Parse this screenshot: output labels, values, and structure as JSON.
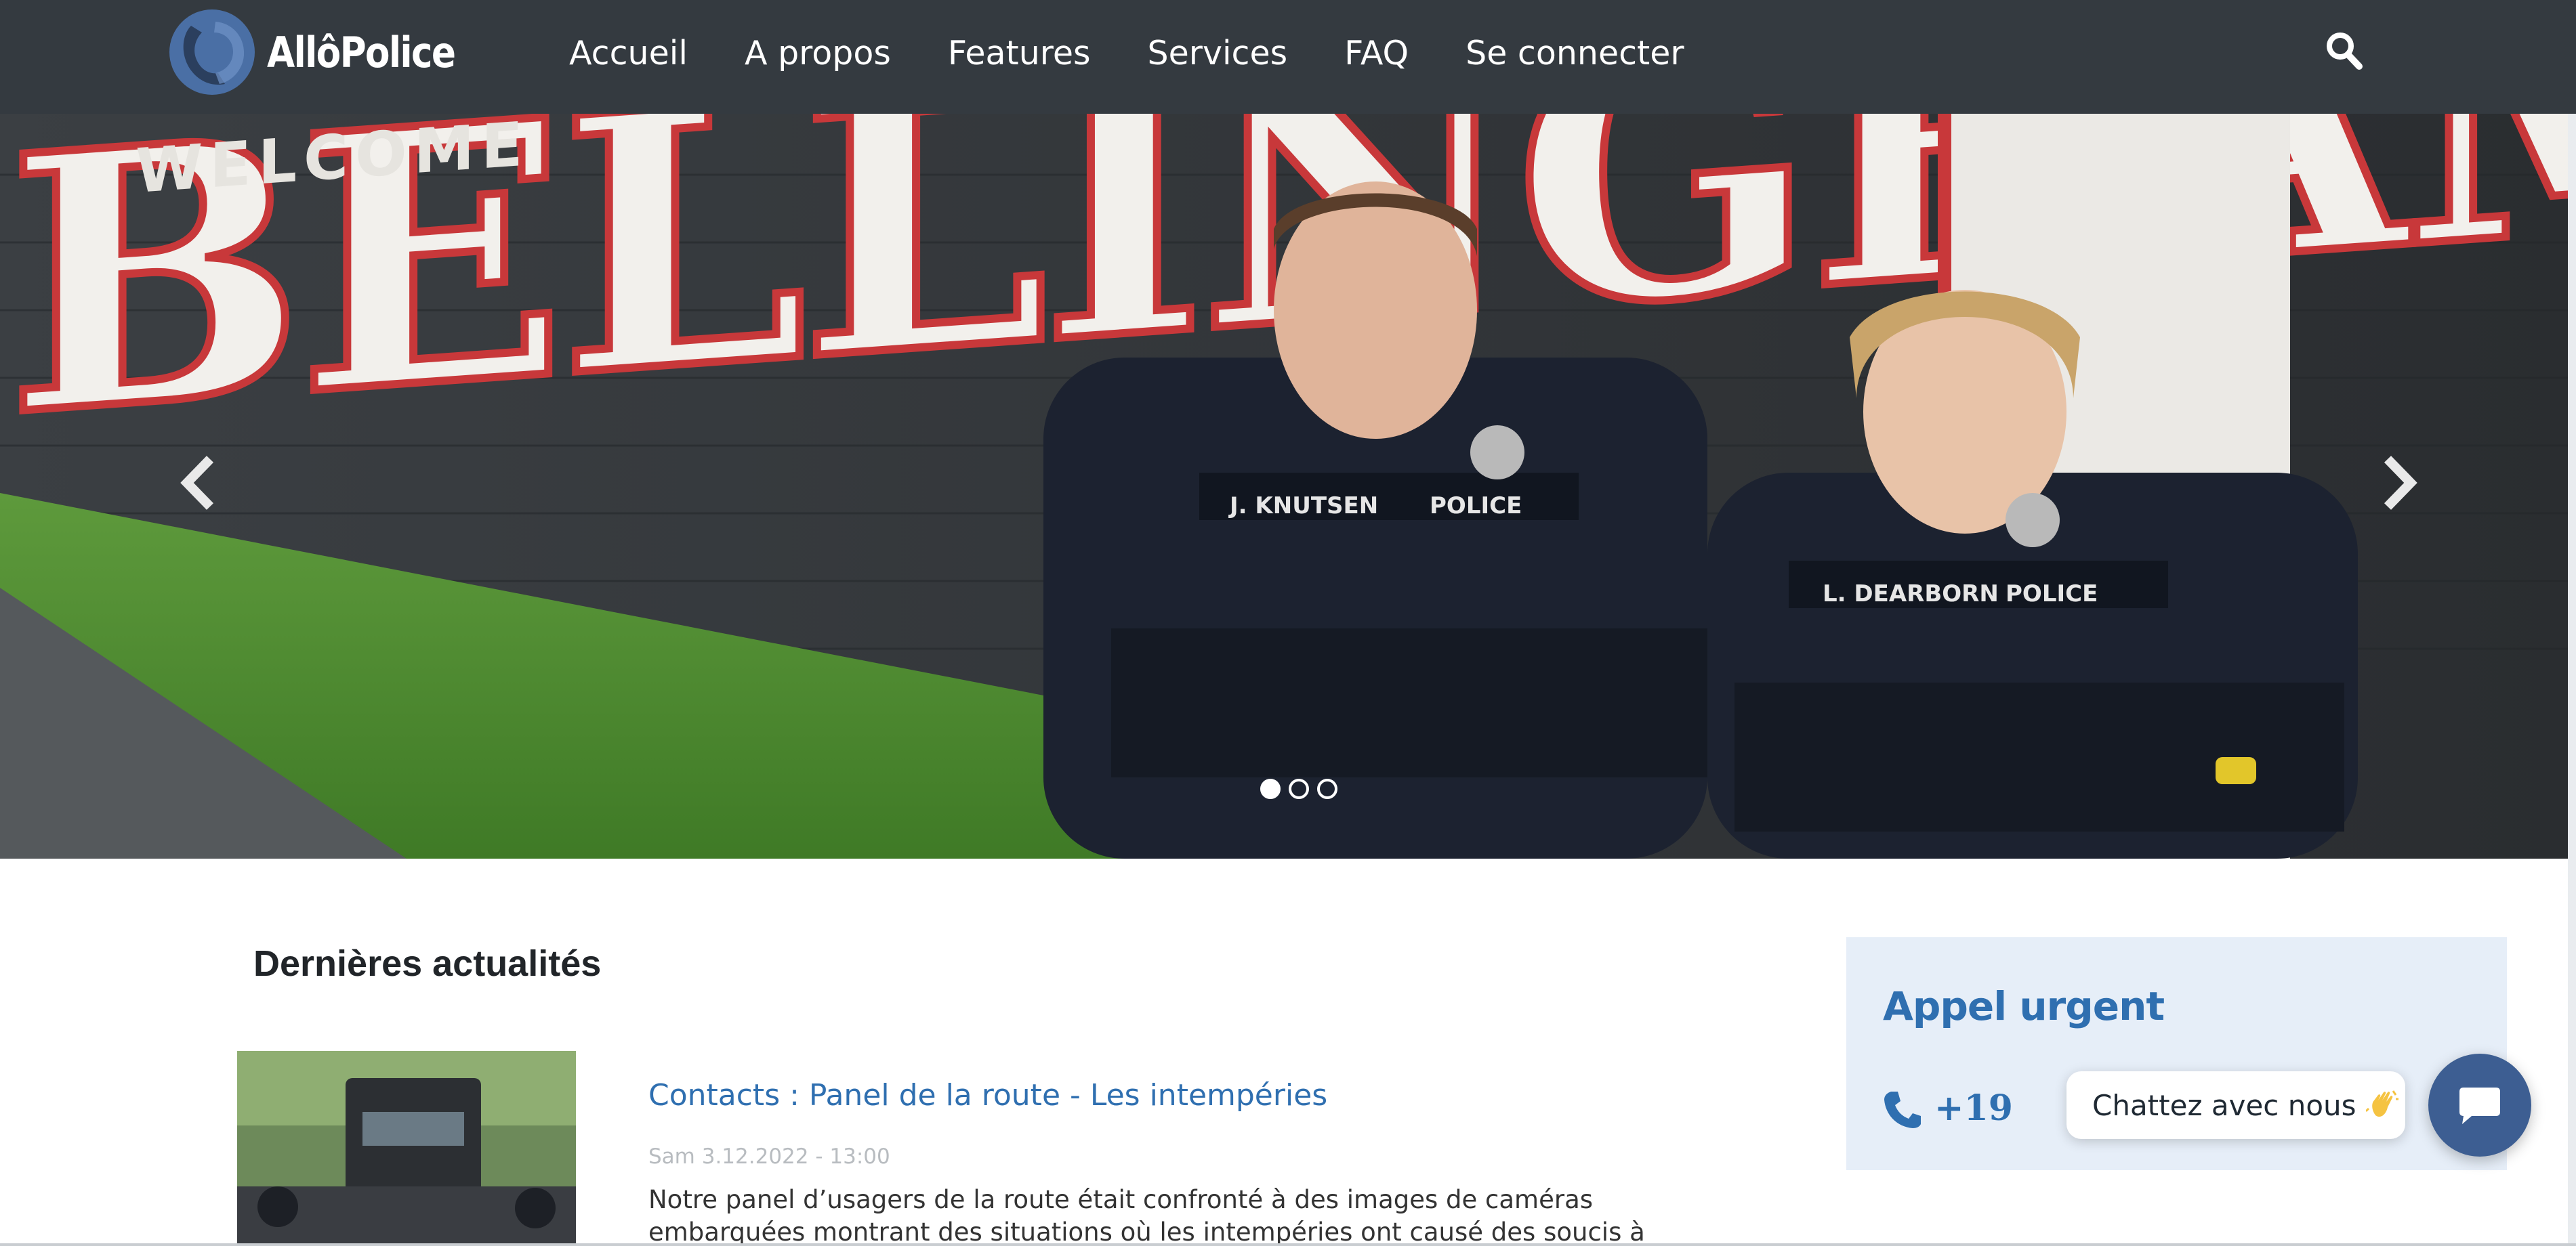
{
  "brand": {
    "name": "AllôPolice"
  },
  "nav": {
    "items": [
      {
        "label": "Accueil"
      },
      {
        "label": "A propos"
      },
      {
        "label": "Features"
      },
      {
        "label": "Services"
      },
      {
        "label": "FAQ"
      },
      {
        "label": "Se connecter"
      }
    ],
    "search_icon": "search-icon"
  },
  "hero": {
    "wall_text": "BELLINGHAM",
    "wall_small_text": "WELCOME",
    "badge_left": "J. KNUTSEN",
    "badge_left_role": "POLICE",
    "badge_right": "L. DEARBORN",
    "badge_right_role": "POLICE",
    "slides": 3,
    "active_slide": 1,
    "prev_icon": "chevron-left-icon",
    "next_icon": "chevron-right-icon"
  },
  "news": {
    "section_title": "Dernières actualités",
    "items": [
      {
        "title": "Contacts : Panel de la route - Les intempéries",
        "date": "Sam 3.12.2022 - 13:00",
        "excerpt": "Notre panel d’usagers de la route était confronté à des images de caméras embarquées montrant des situations où les intempéries ont causé des soucis à des conducteurs."
      }
    ]
  },
  "sidebar": {
    "urgent_title": "Appel urgent",
    "phone_number": "+19",
    "phone_icon": "phone-icon"
  },
  "chat": {
    "bubble_text": "Chattez avec nous",
    "wave_icon": "waving-hand-icon",
    "button_icon": "chat-icon"
  },
  "colors": {
    "navbar_bg": "#343a40",
    "link_blue": "#2f6fb0",
    "urgent_bg": "#e6eef8",
    "chat_button": "#3d5e92"
  }
}
